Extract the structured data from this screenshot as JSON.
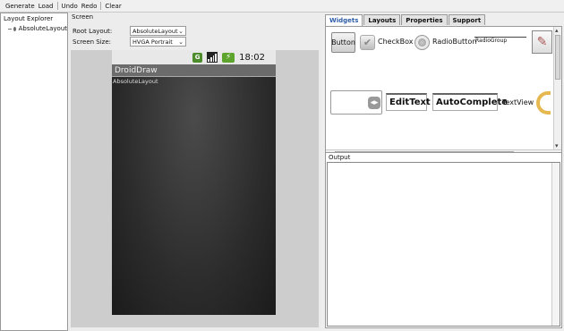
{
  "toolbar": {
    "generate": "Generate",
    "load": "Load",
    "undo": "Undo",
    "redo": "Redo",
    "clear": "Clear"
  },
  "explorer": {
    "title": "Layout Explorer",
    "items": [
      "AbsoluteLayout"
    ]
  },
  "screen": {
    "title": "Screen",
    "root_layout_label": "Root Layout:",
    "root_layout_value": "AbsoluteLayout",
    "screen_size_label": "Screen Size:",
    "screen_size_value": "HVGA Portrait"
  },
  "phone": {
    "status_g": "G",
    "time": "18:02",
    "app_title": "DroidDraw",
    "layout_label": "AbsoluteLayout"
  },
  "tabs": [
    "Widgets",
    "Layouts",
    "Properties",
    "Support"
  ],
  "widgets": {
    "button": "Button",
    "checkbox": "CheckBox",
    "radiobutton": "RadioButton",
    "radiogroup": "RadioGroup",
    "edittext": "EditText",
    "autocomplete": "AutoComplete",
    "textview": "TextView"
  },
  "output": {
    "title": "Output"
  }
}
